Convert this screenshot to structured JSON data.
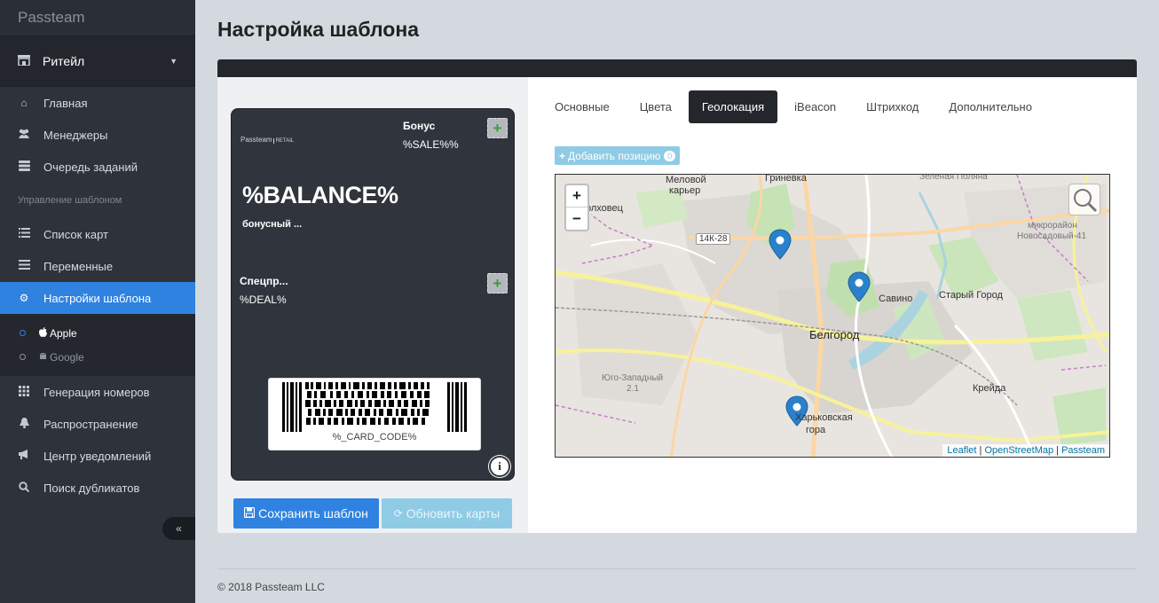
{
  "app": {
    "brand": "Passteam"
  },
  "sidebar": {
    "org": {
      "label": "Ритейл",
      "icon": "store-icon"
    },
    "items": [
      {
        "label": "Главная",
        "icon": "home-icon"
      },
      {
        "label": "Менеджеры",
        "icon": "users-icon"
      },
      {
        "label": "Очередь заданий",
        "icon": "server-icon"
      }
    ],
    "section_header": "Управление шаблоном",
    "items2": [
      {
        "label": "Список карт",
        "icon": "list-icon"
      },
      {
        "label": "Переменные",
        "icon": "lines-icon"
      },
      {
        "label": "Настройки шаблона",
        "icon": "gear-icon"
      }
    ],
    "sub": [
      {
        "label": "Apple",
        "icon": "apple-icon"
      },
      {
        "label": "Google",
        "icon": "android-icon"
      }
    ],
    "items3": [
      {
        "label": "Генерация номеров",
        "icon": "grid-icon"
      },
      {
        "label": "Распространение",
        "icon": "bell-icon"
      },
      {
        "label": "Центр уведомлений",
        "icon": "megaphone-icon"
      },
      {
        "label": "Поиск дубликатов",
        "icon": "search-icon"
      }
    ],
    "collapse": "«"
  },
  "page": {
    "title": "Настройка шаблона"
  },
  "pass": {
    "logo_main": "Passteam",
    "logo_sub": "RETAIL",
    "header_label": "Бонус",
    "header_value": "%SALE%%",
    "primary_value": "%BALANCE%",
    "primary_label": "бонусный ...",
    "secondary_label": "Спецпр...",
    "secondary_value": "%DEAL%",
    "barcode_text": "%_CARD_CODE%",
    "plus": "+",
    "info": "i"
  },
  "buttons": {
    "save": "Сохранить шаблон",
    "refresh": "Обновить карты"
  },
  "tabs": [
    "Основные",
    "Цвета",
    "Геолокация",
    "iBeacon",
    "Штрихкод",
    "Дополнительно"
  ],
  "active_tab": "Геолокация",
  "geo": {
    "add_label": "Добавить позицию",
    "count": "0"
  },
  "map": {
    "zoom_in": "+",
    "zoom_out": "−",
    "labels": {
      "meloviy": "Меловой",
      "karier": "карьер",
      "grinevka": "Гриневка",
      "zelenaya": "Зеленая Поляна",
      "volhovets": "олховец",
      "road": "14К-28",
      "mikro": "микрорайон",
      "novosadovy": "Новосадовый-41",
      "savino": "Савино",
      "stary": "Старый Город",
      "belgorod": "Белгород",
      "yugo": "Юго-Западный",
      "yugo2": "2.1",
      "kreyda": "Крейда",
      "harkov": "Харьковская",
      "gora": "гора"
    },
    "attribution": {
      "leaflet": "Leaflet",
      "osm": "OpenStreetMap",
      "passteam": "Passteam"
    }
  },
  "footer": "© 2018 Passteam LLC",
  "colors": {
    "accent": "#2f82e0",
    "sidebar": "#2e333b",
    "pass_bg": "#30343c",
    "marker": "#2a81cb"
  }
}
